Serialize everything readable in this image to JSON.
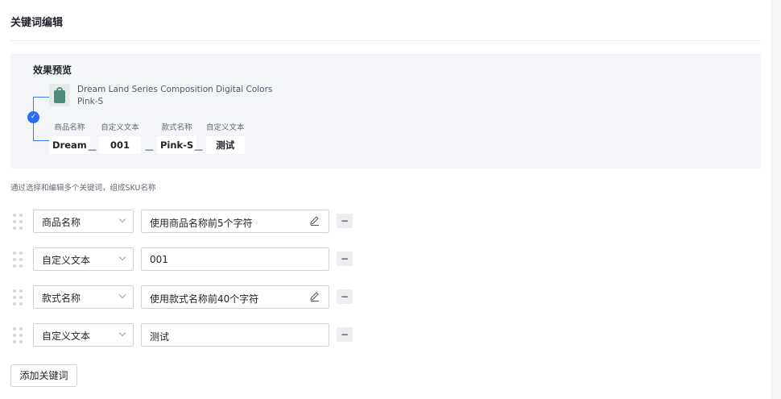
{
  "page": {
    "title": "关键词编辑"
  },
  "preview": {
    "title": "效果预览",
    "product_name": "Dream Land Series Composition Digital Colors Pink-S",
    "chips": [
      {
        "label": "商品名称",
        "value": "Dream"
      },
      {
        "label": "自定义文本",
        "value": "001"
      },
      {
        "label": "款式名称",
        "value": "Pink-S"
      },
      {
        "label": "自定义文本",
        "value": "测试"
      }
    ],
    "separator": "—",
    "check_icon": "checkmark-circle-icon"
  },
  "help_text": "通过选择和编辑多个关键词，组成SKU名称",
  "rows": [
    {
      "select_value": "商品名称",
      "text_value": "使用商品名称前5个字符",
      "editable_icon": true
    },
    {
      "select_value": "自定义文本",
      "text_value": "001",
      "editable_icon": false
    },
    {
      "select_value": "款式名称",
      "text_value": "使用款式名称前40个字符",
      "editable_icon": true
    },
    {
      "select_value": "自定义文本",
      "text_value": "测试",
      "editable_icon": false
    }
  ],
  "minus_label": "−",
  "add_button_label": "添加关键词",
  "colors": {
    "accent": "#2f6bf2",
    "preview_bg": "#f3f5f8",
    "border": "#d0d3d6"
  }
}
